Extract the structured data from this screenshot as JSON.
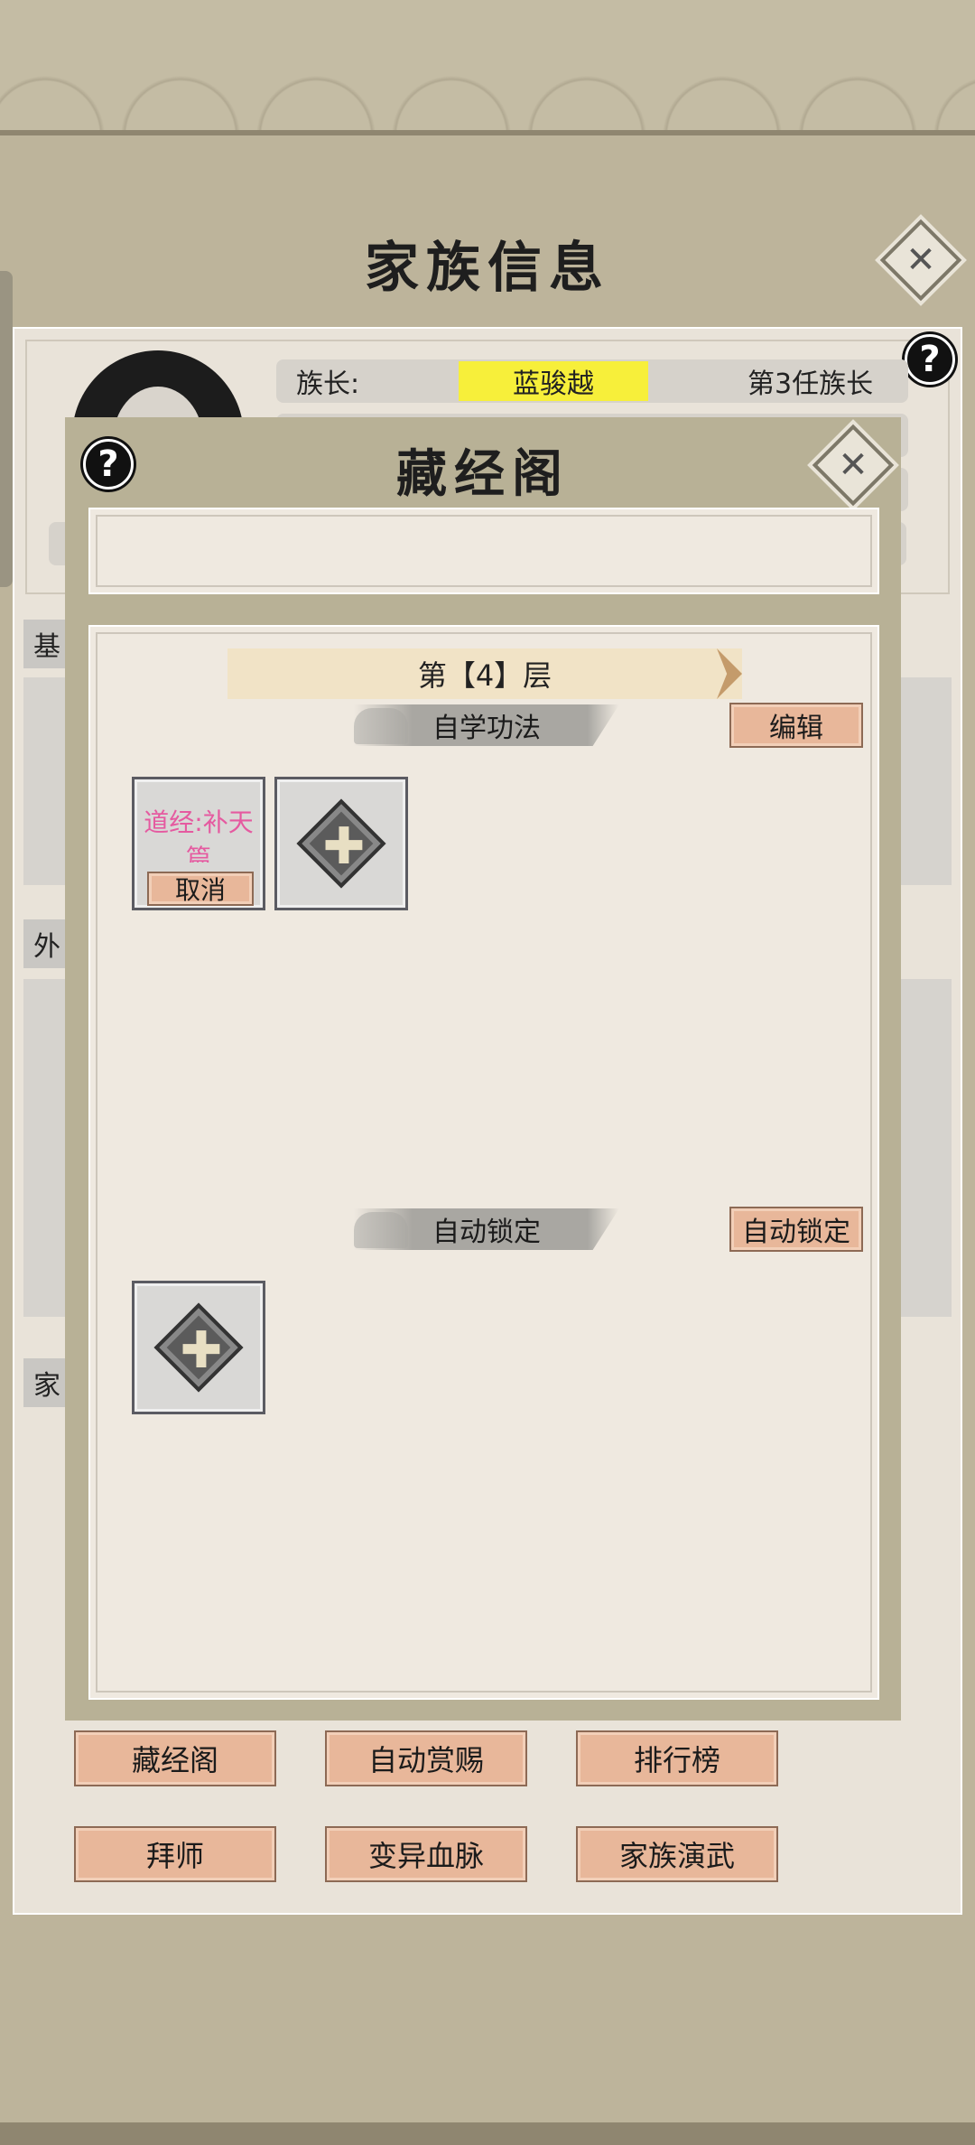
{
  "family_info": {
    "title": "家族信息",
    "leader_label": "族长:",
    "leader_name": "蓝骏越",
    "leader_rank": "第3任族长",
    "tab_base": "基",
    "tab_outer": "外",
    "tab_family": "家",
    "help_symbol": "?",
    "close_symbol": "✕"
  },
  "scripture_modal": {
    "title": "藏经阁",
    "help_symbol": "?",
    "close_symbol": "✕",
    "layer_label": "第【4】层",
    "self_study_title": "自学功法",
    "edit_button": "编辑",
    "self_study_slots": [
      {
        "name": "道经:补天篇",
        "action": "取消"
      },
      {
        "add_symbol": "✚"
      }
    ],
    "auto_lock_title": "自动锁定",
    "auto_lock_button": "自动锁定",
    "auto_lock_slots": [
      {
        "add_symbol": "✚"
      }
    ]
  },
  "bottom_buttons": {
    "row1": [
      "藏经阁",
      "自动赏赐",
      "排行榜"
    ],
    "row2": [
      "拜师",
      "变异血脉",
      "家族演武"
    ]
  },
  "colors": {
    "background": "#bdb49b",
    "panel": "#e9e3d9",
    "modal_frame": "#b8b196",
    "accent_button": "#e8b79a",
    "leader_name_highlight": "#f7ef3a",
    "scripture_name": "#e55aa0"
  },
  "icons": [
    "help-icon",
    "close-icon",
    "plus-icon",
    "cloud-icon"
  ]
}
